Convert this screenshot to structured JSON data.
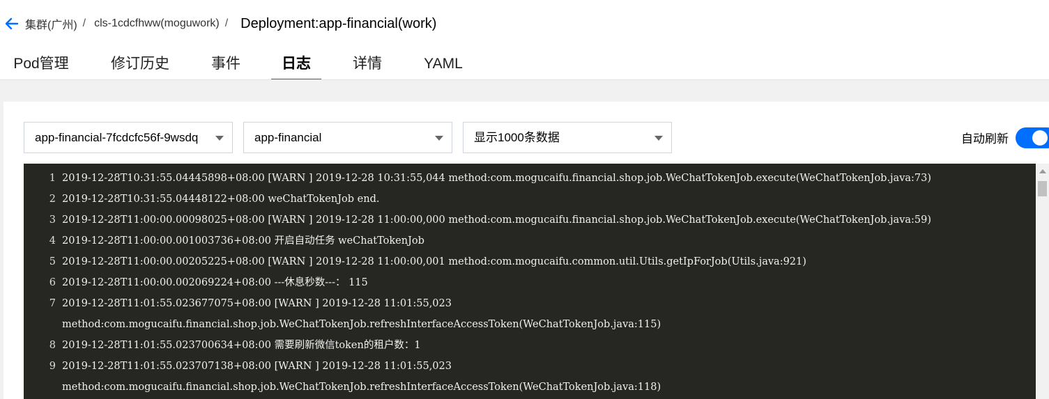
{
  "breadcrumb": {
    "cluster": "集群(广州)",
    "cluster_id": "cls-1cdcfhww(moguwork)",
    "current": "Deployment:app-financial(work)",
    "separator": "/"
  },
  "tabs": [
    {
      "label": "Pod管理",
      "active": false
    },
    {
      "label": "修订历史",
      "active": false
    },
    {
      "label": "事件",
      "active": false
    },
    {
      "label": "日志",
      "active": true
    },
    {
      "label": "详情",
      "active": false
    },
    {
      "label": "YAML",
      "active": false
    }
  ],
  "filters": {
    "pod": "app-financial-7fcdcfc56f-9wsdq",
    "container": "app-financial",
    "limit": "显示1000条数据"
  },
  "auto_refresh": {
    "label": "自动刷新",
    "enabled": true
  },
  "log_lines": [
    {
      "num": "1",
      "text": "2019-12-28T10:31:55.04445898+08:00 [WARN ] 2019-12-28 10:31:55,044 method:com.mogucaifu.financial.shop.job.WeChatTokenJob.execute(WeChatTokenJob.java:73)"
    },
    {
      "num": "2",
      "text": "2019-12-28T10:31:55.04448122+08:00 weChatTokenJob end."
    },
    {
      "num": "3",
      "text": "2019-12-28T11:00:00.00098025+08:00 [WARN ] 2019-12-28 11:00:00,000 method:com.mogucaifu.financial.shop.job.WeChatTokenJob.execute(WeChatTokenJob.java:59)"
    },
    {
      "num": "4",
      "text": "2019-12-28T11:00:00.001003736+08:00 开启自动任务 weChatTokenJob"
    },
    {
      "num": "5",
      "text": "2019-12-28T11:00:00.00205225+08:00 [WARN ] 2019-12-28 11:00:00,001 method:com.mogucaifu.common.util.Utils.getIpForJob(Utils.java:921)"
    },
    {
      "num": "6",
      "text": "2019-12-28T11:00:00.002069224+08:00 ---休息秒数---： 115"
    },
    {
      "num": "7",
      "text": "2019-12-28T11:01:55.023677075+08:00 [WARN ] 2019-12-28 11:01:55,023"
    },
    {
      "num": "",
      "text": "method:com.mogucaifu.financial.shop.job.WeChatTokenJob.refreshInterfaceAccessToken(WeChatTokenJob.java:115)"
    },
    {
      "num": "8",
      "text": "2019-12-28T11:01:55.023700634+08:00 需要刷新微信token的租户数：1"
    },
    {
      "num": "9",
      "text": "2019-12-28T11:01:55.023707138+08:00 [WARN ] 2019-12-28 11:01:55,023"
    },
    {
      "num": "",
      "text": "method:com.mogucaifu.financial.shop.job.WeChatTokenJob.refreshInterfaceAccessToken(WeChatTokenJob.java:118)"
    }
  ],
  "colors": {
    "accent": "#006eff",
    "log_background": "#262622",
    "log_text": "#f0f0f0"
  }
}
